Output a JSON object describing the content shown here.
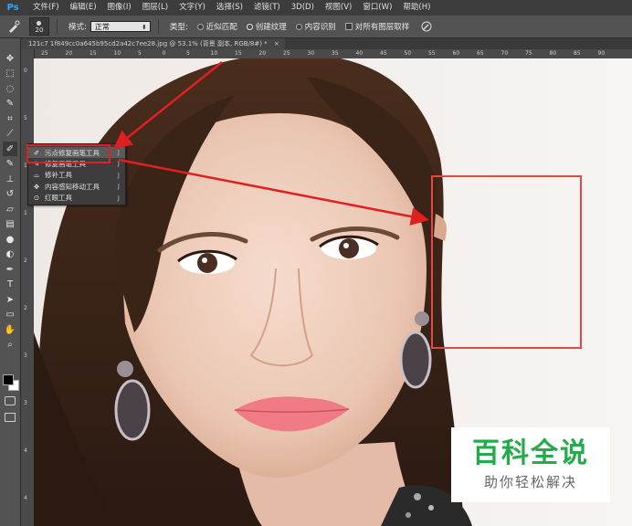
{
  "app": {
    "logo": "Ps",
    "accent": "#31a8ff"
  },
  "menu": [
    "文件(F)",
    "编辑(E)",
    "图像(I)",
    "图层(L)",
    "文字(Y)",
    "选择(S)",
    "滤镜(T)",
    "3D(D)",
    "视图(V)",
    "窗口(W)",
    "帮助(H)"
  ],
  "options": {
    "brush_size": "20",
    "mode_label": "模式:",
    "mode_value": "正常",
    "type_label": "类型:",
    "type_options": [
      {
        "label": "近似匹配",
        "selected": false
      },
      {
        "label": "创建纹理",
        "selected": true
      },
      {
        "label": "内容识别",
        "selected": false
      }
    ],
    "sample_all_label": "对所有图层取样",
    "sample_all_checked": false
  },
  "document": {
    "tab_title": "121c7 1f849cc0a645b95cd2a42c7ee28.jpg @ 53.1% (背景 副本, RGB/8#) *",
    "close": "×"
  },
  "ruler": {
    "h_ticks": [
      "25",
      "20",
      "15",
      "10",
      "5",
      "0",
      "5",
      "10",
      "15",
      "20",
      "25",
      "30",
      "35",
      "40",
      "45",
      "50",
      "55",
      "60",
      "65",
      "70",
      "75",
      "80",
      "85",
      "90"
    ],
    "v_ticks": [
      "0",
      "5",
      "1",
      "1",
      "2",
      "2",
      "3",
      "3",
      "4",
      "4"
    ]
  },
  "flyout": [
    {
      "label": "污点修复画笔工具",
      "key": "J",
      "icon": "spot-healing-brush-icon",
      "selected": true
    },
    {
      "label": "修复画笔工具",
      "key": "J",
      "icon": "healing-brush-icon",
      "selected": false
    },
    {
      "label": "修补工具",
      "key": "J",
      "icon": "patch-icon",
      "selected": false
    },
    {
      "label": "内容感知移动工具",
      "key": "J",
      "icon": "content-aware-move-icon",
      "selected": false
    },
    {
      "label": "红眼工具",
      "key": "J",
      "icon": "red-eye-icon",
      "selected": false
    }
  ],
  "tools": [
    "move-icon",
    "marquee-icon",
    "lasso-icon",
    "quick-select-icon",
    "crop-icon",
    "eyedropper-icon",
    "spot-healing-brush-icon",
    "brush-icon",
    "clone-stamp-icon",
    "history-brush-icon",
    "eraser-icon",
    "gradient-icon",
    "blur-icon",
    "dodge-icon",
    "pen-icon",
    "type-icon",
    "path-select-icon",
    "rectangle-icon",
    "hand-icon",
    "zoom-icon"
  ],
  "watermark": {
    "title": "百科全说",
    "subtitle": "助你轻松解决",
    "color": "#25ab4a"
  },
  "annotation_color": "#e02020"
}
